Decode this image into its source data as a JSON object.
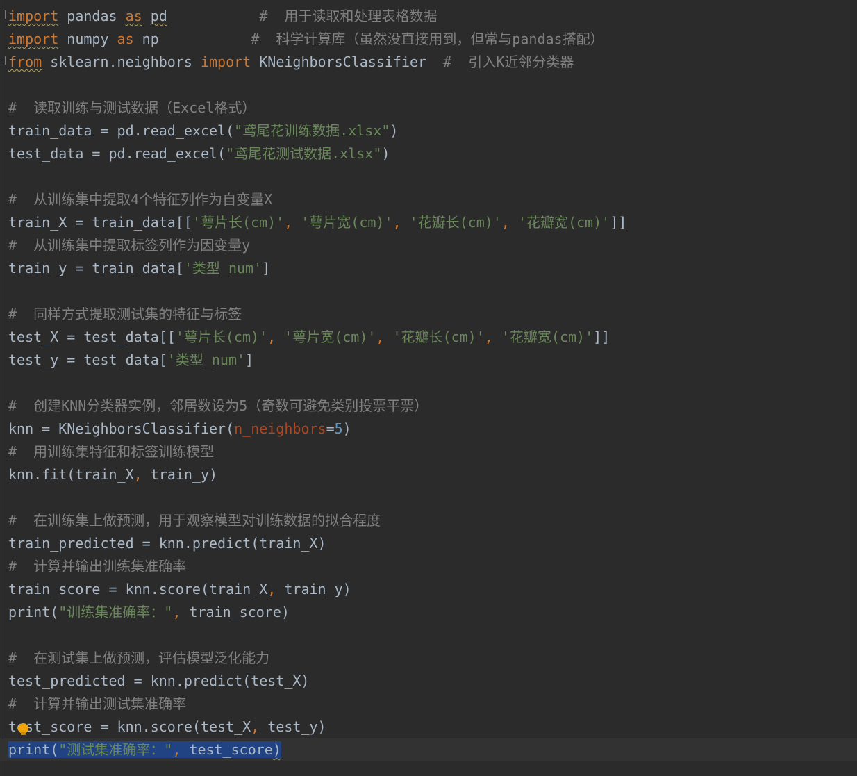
{
  "editor": {
    "language": "python",
    "current_line": 33,
    "intention_action": "lightbulb-icon",
    "lines": [
      [
        [
          "kw wavy",
          "import"
        ],
        [
          "plain",
          " pandas "
        ],
        [
          "kw wavy",
          "as"
        ],
        [
          "plain",
          " "
        ],
        [
          "plain wavy",
          "pd"
        ],
        [
          "plain",
          "           "
        ],
        [
          "com",
          "#  用于读取和处理表格数据"
        ]
      ],
      [
        [
          "kw wavy",
          "import"
        ],
        [
          "plain",
          " numpy "
        ],
        [
          "kw",
          "as"
        ],
        [
          "plain",
          " np           "
        ],
        [
          "com",
          "#  科学计算库（虽然没直接用到，但常与pandas搭配）"
        ]
      ],
      [
        [
          "kw wavy",
          "from"
        ],
        [
          "plain",
          " sklearn.neighbors "
        ],
        [
          "kw",
          "import"
        ],
        [
          "plain",
          " KNeighborsClassifier  "
        ],
        [
          "com",
          "#  引入K近邻分类器"
        ]
      ],
      [],
      [
        [
          "com",
          "#  读取训练与测试数据（Excel格式）"
        ]
      ],
      [
        [
          "plain",
          "train_data = pd.read_excel("
        ],
        [
          "str",
          "\"鸢尾花训练数据.xlsx\""
        ],
        [
          "plain",
          ")"
        ]
      ],
      [
        [
          "plain",
          "test_data = pd.read_excel("
        ],
        [
          "str",
          "\"鸢尾花测试数据.xlsx\""
        ],
        [
          "plain",
          ")"
        ]
      ],
      [],
      [
        [
          "com",
          "#  从训练集中提取4个特征列作为自变量X"
        ]
      ],
      [
        [
          "plain",
          "train_X = train_data[["
        ],
        [
          "str",
          "'萼片长(cm)'"
        ],
        [
          "punct",
          ", "
        ],
        [
          "str",
          "'萼片宽(cm)'"
        ],
        [
          "punct",
          ", "
        ],
        [
          "str",
          "'花瓣长(cm)'"
        ],
        [
          "punct",
          ", "
        ],
        [
          "str",
          "'花瓣宽(cm)'"
        ],
        [
          "plain",
          "]]"
        ]
      ],
      [
        [
          "com",
          "#  从训练集中提取标签列作为因变量y"
        ]
      ],
      [
        [
          "plain",
          "train_y = train_data["
        ],
        [
          "str",
          "'类型_num'"
        ],
        [
          "plain",
          "]"
        ]
      ],
      [],
      [
        [
          "com",
          "#  同样方式提取测试集的特征与标签"
        ]
      ],
      [
        [
          "plain",
          "test_X = test_data[["
        ],
        [
          "str",
          "'萼片长(cm)'"
        ],
        [
          "punct",
          ", "
        ],
        [
          "str",
          "'萼片宽(cm)'"
        ],
        [
          "punct",
          ", "
        ],
        [
          "str",
          "'花瓣长(cm)'"
        ],
        [
          "punct",
          ", "
        ],
        [
          "str",
          "'花瓣宽(cm)'"
        ],
        [
          "plain",
          "]]"
        ]
      ],
      [
        [
          "plain",
          "test_y = test_data["
        ],
        [
          "str",
          "'类型_num'"
        ],
        [
          "plain",
          "]"
        ]
      ],
      [],
      [
        [
          "com",
          "#  创建KNN分类器实例，邻居数设为5（奇数可避免类别投票平票）"
        ]
      ],
      [
        [
          "plain",
          "knn = KNeighborsClassifier("
        ],
        [
          "param",
          "n_neighbors"
        ],
        [
          "plain",
          "="
        ],
        [
          "num",
          "5"
        ],
        [
          "plain",
          ")"
        ]
      ],
      [
        [
          "com",
          "#  用训练集特征和标签训练模型"
        ]
      ],
      [
        [
          "plain",
          "knn.fit(train_X"
        ],
        [
          "punct",
          ", "
        ],
        [
          "plain",
          "train_y)"
        ]
      ],
      [],
      [
        [
          "com",
          "#  在训练集上做预测，用于观察模型对训练数据的拟合程度"
        ]
      ],
      [
        [
          "plain",
          "train_predicted = knn.predict(train_X)"
        ]
      ],
      [
        [
          "com",
          "#  计算并输出训练集准确率"
        ]
      ],
      [
        [
          "plain",
          "train_score = knn.score(train_X"
        ],
        [
          "punct",
          ", "
        ],
        [
          "plain",
          "train_y)"
        ]
      ],
      [
        [
          "plain",
          "print("
        ],
        [
          "str",
          "\"训练集准确率：\""
        ],
        [
          "punct",
          ", "
        ],
        [
          "plain",
          "train_score)"
        ]
      ],
      [],
      [
        [
          "com",
          "#  在测试集上做预测，评估模型泛化能力"
        ]
      ],
      [
        [
          "plain",
          "test_predicted = knn.predict(test_X)"
        ]
      ],
      [
        [
          "com",
          "#  计算并输出测试集准确率"
        ]
      ],
      [
        [
          "plain",
          "test_score = knn.score(test_X"
        ],
        [
          "punct",
          ", "
        ],
        [
          "plain",
          "test_y)"
        ]
      ],
      [
        [
          "plain sel",
          "print("
        ],
        [
          "str sel",
          "\"测试集准确率：\""
        ],
        [
          "punct sel",
          ", "
        ],
        [
          "plain sel",
          "test_score"
        ],
        [
          "plain sel endwavy",
          ")"
        ]
      ]
    ]
  }
}
